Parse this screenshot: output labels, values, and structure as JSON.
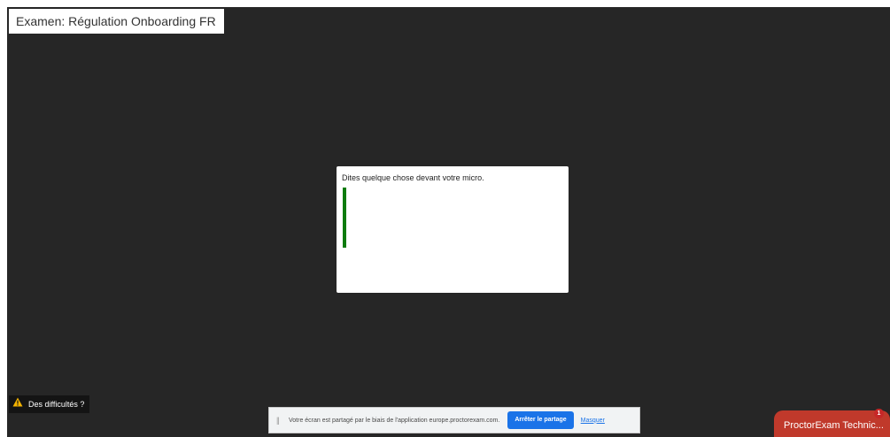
{
  "exam": {
    "title": "Examen: Régulation Onboarding FR"
  },
  "mic_check": {
    "message": "Dites quelque chose devant votre micro.",
    "level": 1.0,
    "meter_color": "#0e7b0e"
  },
  "help": {
    "label": "Des difficultés ?",
    "icon": "warning-icon",
    "icon_color": "#f5b400"
  },
  "screen_share_bar": {
    "message": "Votre écran est partagé par le biais de l'application europe.proctorexam.com.",
    "stop_label": "Arrêter le partage",
    "hide_label": "Masquer",
    "accent": "#1a73e8"
  },
  "support_chat": {
    "label": "ProctorExam Technic...",
    "badge_count": "1",
    "color": "#c0392b"
  }
}
